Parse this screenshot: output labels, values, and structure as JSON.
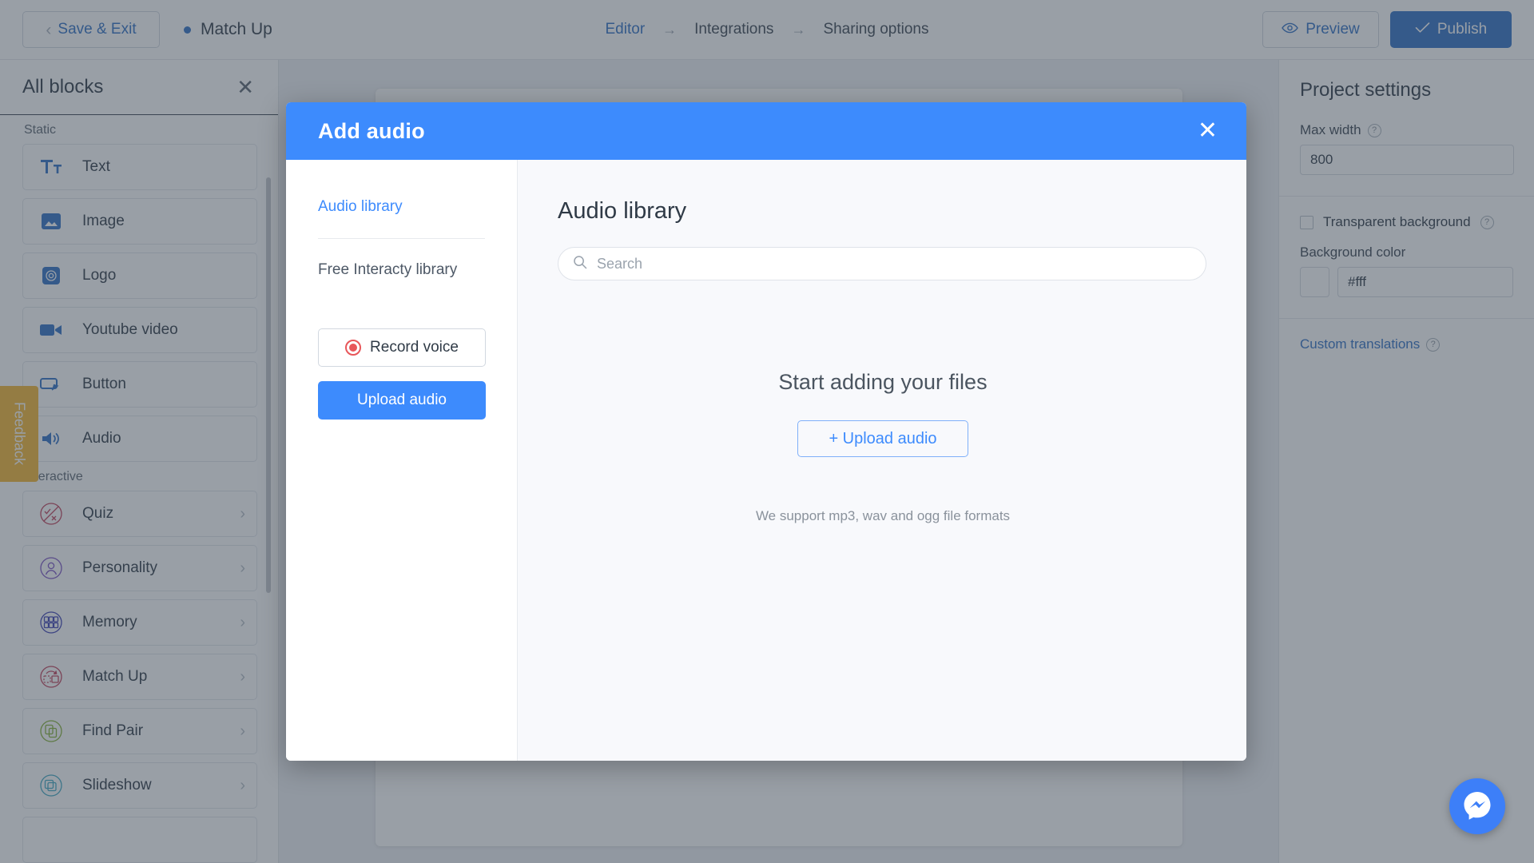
{
  "topbar": {
    "save_exit_label": "Save & Exit",
    "back_chevron_icon": "chevron-left-icon",
    "project_name": "Match Up",
    "status_dot_color": "#2f6fc4",
    "breadcrumb": [
      {
        "label": "Editor",
        "active": true
      },
      {
        "label": "Integrations",
        "active": false
      },
      {
        "label": "Sharing options",
        "active": false
      }
    ],
    "breadcrumb_arrow": "→",
    "preview_label": "Preview",
    "preview_icon": "eye-icon",
    "publish_label": "Publish",
    "publish_icon": "check-icon",
    "publish_color": "#2f6fc4"
  },
  "left_panel": {
    "title": "All blocks",
    "close_icon": "close-icon",
    "groups": [
      {
        "label": "Static",
        "items": [
          {
            "label": "Text",
            "icon": "text-icon",
            "chevron": false
          },
          {
            "label": "Image",
            "icon": "image-icon",
            "chevron": false
          },
          {
            "label": "Logo",
            "icon": "logo-icon",
            "chevron": false
          },
          {
            "label": "Youtube video",
            "icon": "video-icon",
            "chevron": false
          },
          {
            "label": "Button",
            "icon": "button-icon",
            "chevron": false
          },
          {
            "label": "Audio",
            "icon": "audio-icon",
            "chevron": false
          }
        ]
      },
      {
        "label": "Interactive",
        "items": [
          {
            "label": "Quiz",
            "icon": "quiz-icon",
            "chevron": true
          },
          {
            "label": "Personality",
            "icon": "personality-icon",
            "chevron": true
          },
          {
            "label": "Memory",
            "icon": "memory-icon",
            "chevron": true
          },
          {
            "label": "Match Up",
            "icon": "match-up-icon",
            "chevron": true
          },
          {
            "label": "Find Pair",
            "icon": "find-pair-icon",
            "chevron": true
          },
          {
            "label": "Slideshow",
            "icon": "slideshow-icon",
            "chevron": true
          }
        ]
      }
    ]
  },
  "right_panel": {
    "title": "Project settings",
    "max_width_label": "Max width",
    "max_width_value": "800",
    "transparent_background_label": "Transparent background",
    "transparent_background_checked": false,
    "background_color_label": "Background color",
    "background_color_value": "#fff",
    "custom_translations_label": "Custom translations",
    "help_icon": "question-mark-icon"
  },
  "feedback": {
    "label": "Feedback",
    "color": "#f5b731"
  },
  "messenger": {
    "icon": "messenger-icon",
    "color": "#3d7ff8"
  },
  "modal": {
    "title": "Add audio",
    "header_color": "#3d8bfd",
    "close_icon": "close-icon",
    "nav": {
      "audio_library_label": "Audio library",
      "free_library_label": "Free Interacty library",
      "record_voice_label": "Record voice",
      "record_icon": "record-dot-icon",
      "upload_audio_label": "Upload audio"
    },
    "main": {
      "heading": "Audio library",
      "search_placeholder": "Search",
      "search_value": "",
      "search_icon": "search-icon",
      "empty_title": "Start adding your files",
      "upload_button_label": "+ Upload audio",
      "support_note": "We support mp3, wav and ogg file formats"
    }
  }
}
